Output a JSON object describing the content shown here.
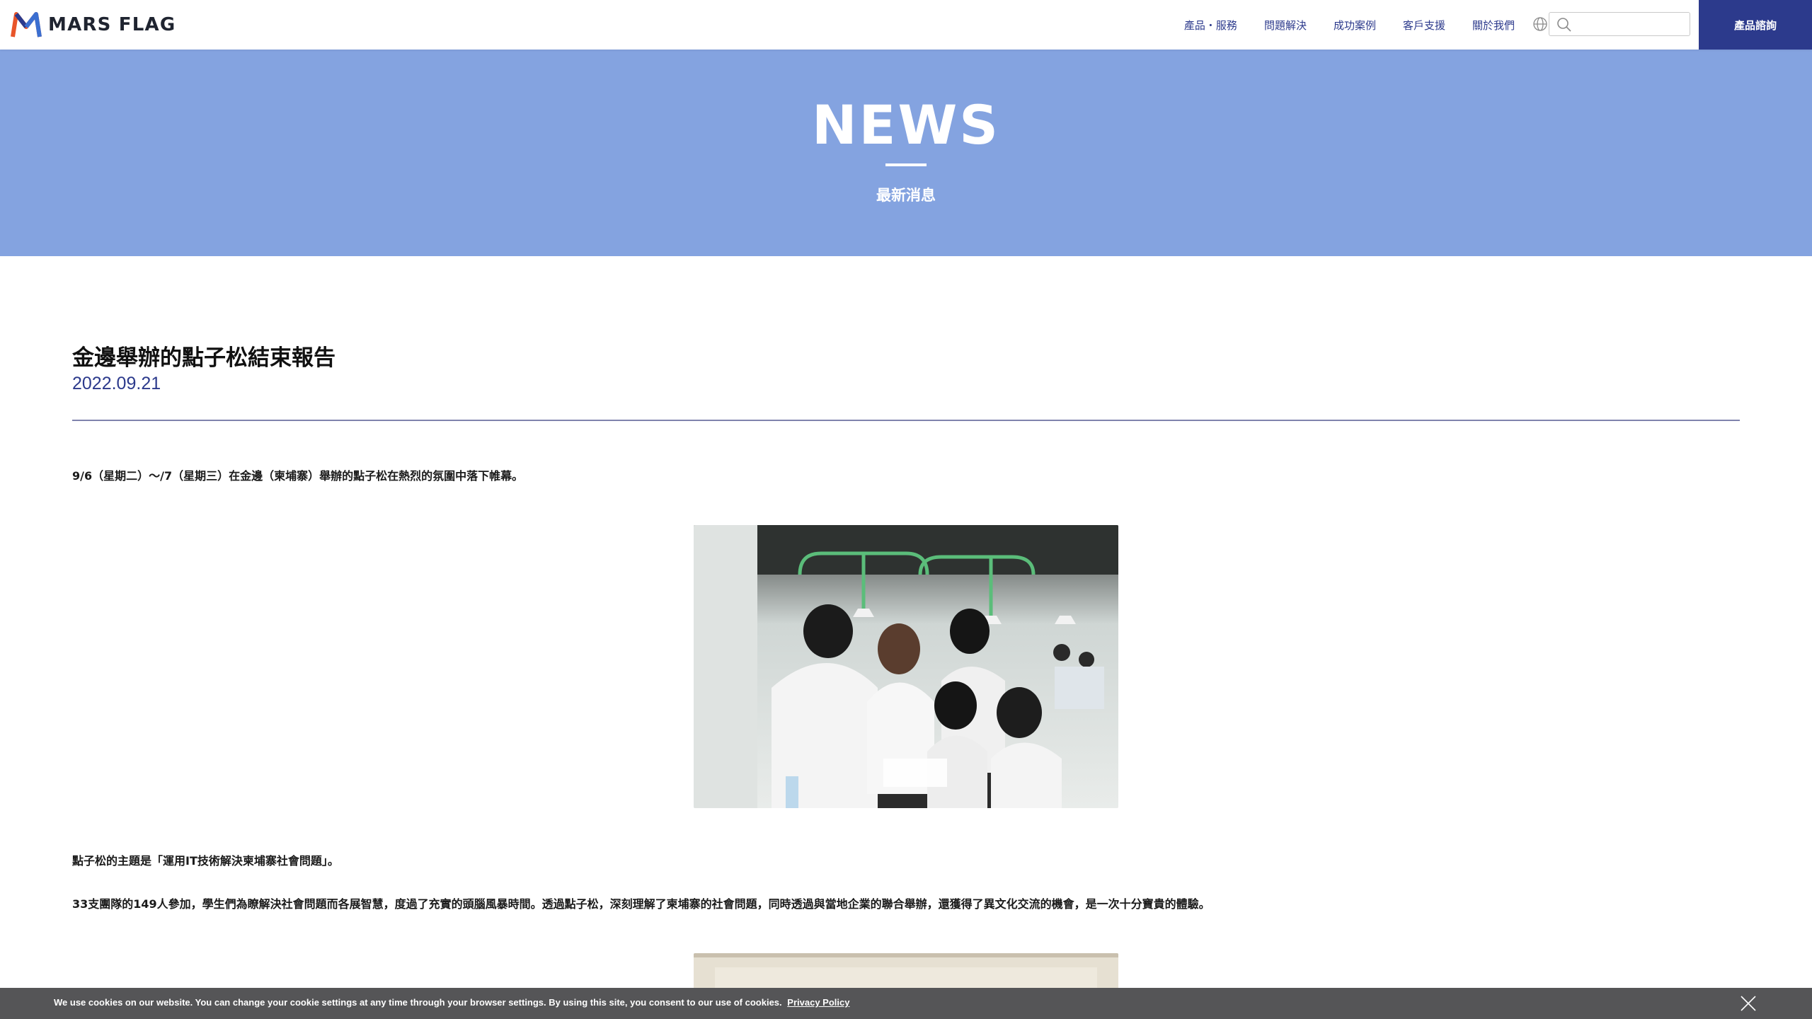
{
  "header": {
    "brand": "MARS FLAG",
    "nav": [
      "產品・服務",
      "問題解決",
      "成功案例",
      "客戶支援",
      "關於我們"
    ],
    "search_placeholder": "",
    "cta_label": "產品諮詢",
    "icons": [
      "mars-flag-logo",
      "globe-icon",
      "search-icon"
    ]
  },
  "banner": {
    "title": "NEWS",
    "subtitle": "最新消息",
    "background": "#84a3e0"
  },
  "article": {
    "title": "金邊舉辦的點子松結束報告",
    "date": "2022.09.21",
    "intro": "9/6（星期二）～/7（星期三）在金邊（柬埔寨）舉辦的點子松在熱烈的氛圍中落下帷幕。",
    "theme": "點子松的主題是「運用IT技術解決柬埔寨社會問題」。",
    "summary": "33支團隊的149人參加，學生們為瞭解決社會問題而各展智慧，度過了充實的頭腦風暴時間。透過點子松，深刻理解了柬埔寨的社會問題，同時透過與當地企業的聯合舉辦，還獲得了異文化交流的機會，是一次十分寶貴的體驗。",
    "accent_color": "#2c3a8c"
  },
  "cookie": {
    "message": "We use cookies on our website. You can change your cookie settings at any time through your browser settings. By using this site, you consent to our use of cookies.",
    "link": "Privacy Policy"
  }
}
